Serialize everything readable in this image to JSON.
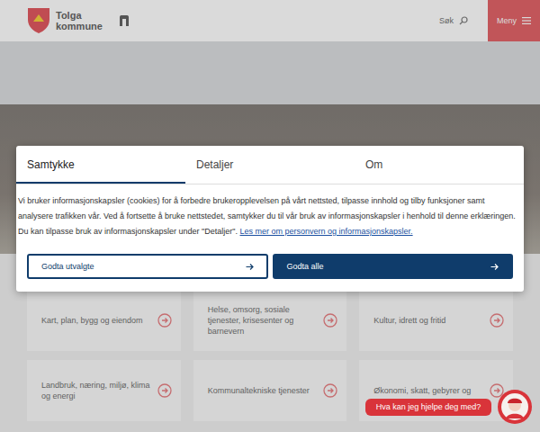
{
  "header": {
    "logo_lines": [
      "Tolga",
      "kommune"
    ],
    "search": "Søk",
    "menu": "Meny"
  },
  "consent": {
    "tabs": [
      {
        "label": "Samtykke",
        "selected": true
      },
      {
        "label": "Detaljer",
        "selected": false
      },
      {
        "label": "Om",
        "selected": false
      }
    ],
    "body": "Vi bruker informasjonskapsler (cookies) for å forbedre brukeropplevelsen på vårt nettsted, tilpasse innhold og tilby funksjoner samt analysere trafikken vår. Ved å fortsette å bruke nettstedet, samtykker du til vår bruk av informasjonskapsler i henhold til denne erklæringen. Du kan tilpasse bruk av informasjonskapsler under \"Detaljer\". ",
    "link": "Les mer om personvern og informasjonskapsler.",
    "buttons": [
      {
        "label": "Godta utvalgte",
        "primary": false
      },
      {
        "label": "Godta alle",
        "primary": true
      }
    ]
  },
  "categories": [
    "Kart, plan, bygg og eiendom",
    "Helse, omsorg, sosiale tjenester, krisesenter og barnevern",
    "Kultur, idrett og fritid",
    "Landbruk, næring, miljø, klima og energi",
    "Kommunaltekniske tjenester",
    "Økonomi, skatt, gebyrer og"
  ],
  "chat": {
    "text": "Hva kan jeg hjelpe deg med?"
  }
}
